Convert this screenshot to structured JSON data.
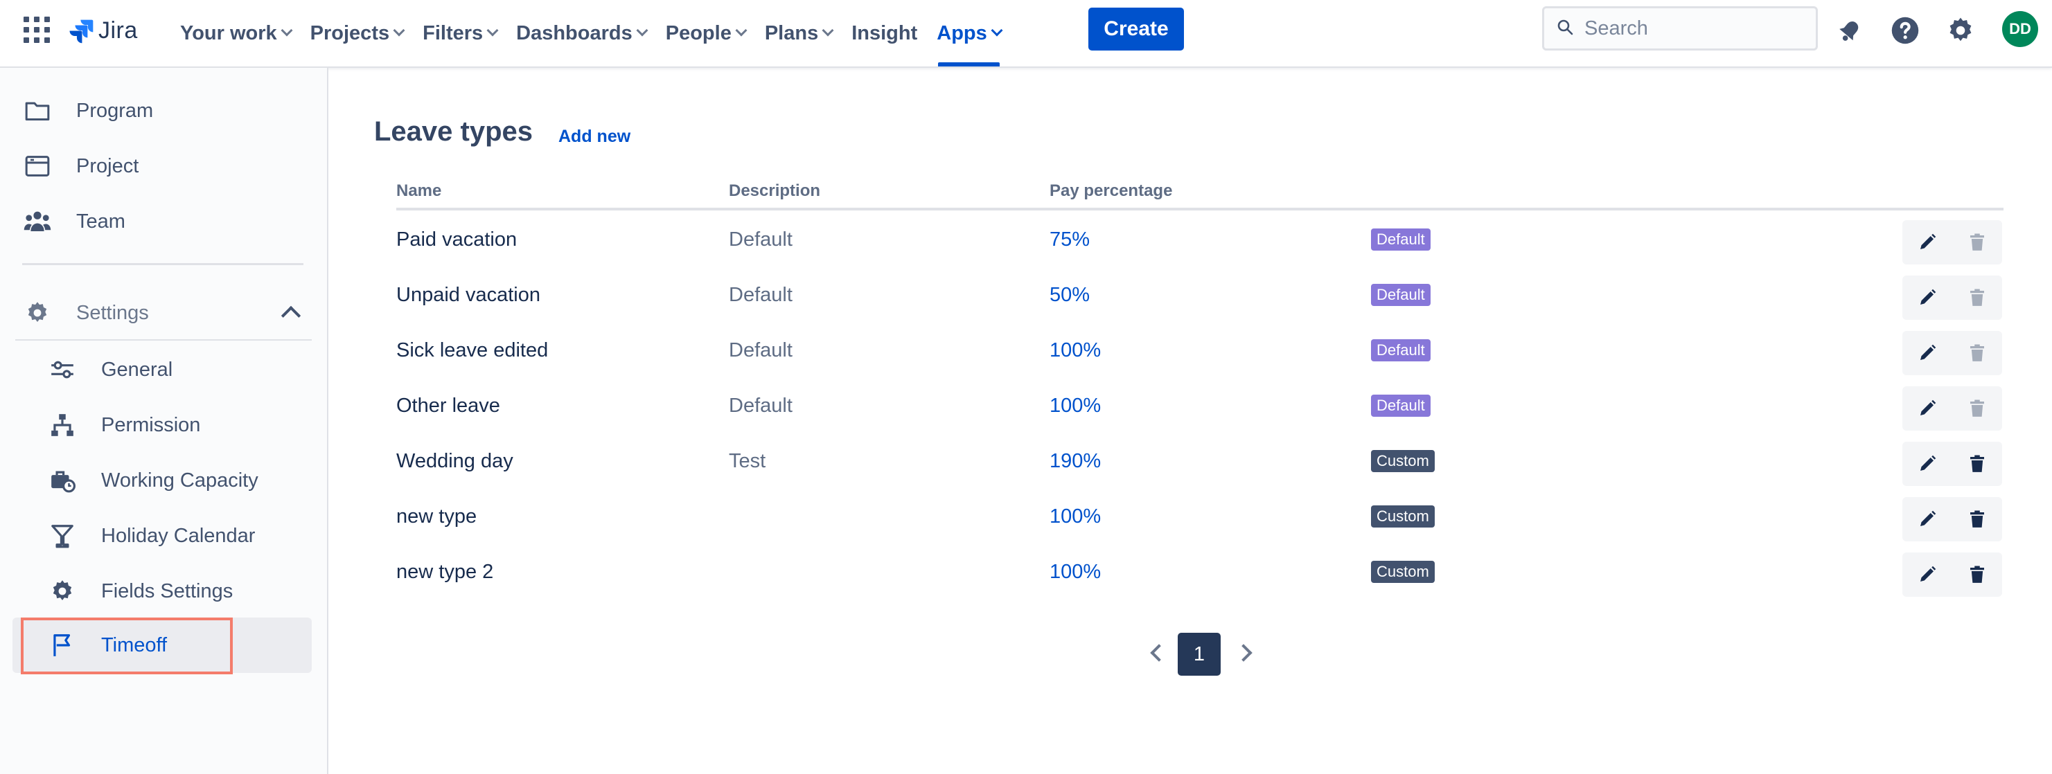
{
  "header": {
    "logo_text": "Jira",
    "nav": [
      {
        "label": "Your work",
        "dropdown": true
      },
      {
        "label": "Projects",
        "dropdown": true
      },
      {
        "label": "Filters",
        "dropdown": true
      },
      {
        "label": "Dashboards",
        "dropdown": true
      },
      {
        "label": "People",
        "dropdown": true
      },
      {
        "label": "Plans",
        "dropdown": true
      },
      {
        "label": "Insight",
        "dropdown": false
      },
      {
        "label": "Apps",
        "dropdown": true,
        "active": true
      }
    ],
    "create_label": "Create",
    "search_placeholder": "Search",
    "avatar_initials": "DD",
    "icons": [
      "app-switcher-icon",
      "notifications-icon",
      "help-icon",
      "settings-icon"
    ]
  },
  "sidebar": {
    "top_items": [
      {
        "label": "Program",
        "icon": "folder-icon"
      },
      {
        "label": "Project",
        "icon": "project-icon"
      },
      {
        "label": "Team",
        "icon": "team-icon"
      }
    ],
    "settings": {
      "label": "Settings",
      "icon": "gear-icon",
      "expanded": true,
      "items": [
        {
          "label": "General",
          "icon": "sliders-icon"
        },
        {
          "label": "Permission",
          "icon": "hierarchy-icon"
        },
        {
          "label": "Working Capacity",
          "icon": "briefcase-clock-icon"
        },
        {
          "label": "Holiday Calendar",
          "icon": "cocktail-icon"
        },
        {
          "label": "Fields Settings",
          "icon": "gear-icon"
        },
        {
          "label": "Timeoff",
          "icon": "flag-icon",
          "selected": true
        }
      ]
    }
  },
  "main": {
    "title": "Leave types",
    "add_new_label": "Add new",
    "columns": {
      "name": "Name",
      "description": "Description",
      "pay": "Pay percentage"
    },
    "rows": [
      {
        "name": "Paid vacation",
        "description": "Default",
        "pay": "75%",
        "badge": "Default",
        "deletable": false
      },
      {
        "name": "Unpaid vacation",
        "description": "Default",
        "pay": "50%",
        "badge": "Default",
        "deletable": false
      },
      {
        "name": "Sick leave edited",
        "description": "Default",
        "pay": "100%",
        "badge": "Default",
        "deletable": false
      },
      {
        "name": "Other leave",
        "description": "Default",
        "pay": "100%",
        "badge": "Default",
        "deletable": false
      },
      {
        "name": "Wedding day",
        "description": "Test",
        "pay": "190%",
        "badge": "Custom",
        "deletable": true
      },
      {
        "name": "new type",
        "description": "",
        "pay": "100%",
        "badge": "Custom",
        "deletable": true
      },
      {
        "name": "new type 2",
        "description": "",
        "pay": "100%",
        "badge": "Custom",
        "deletable": true
      }
    ],
    "pagination": {
      "current_page": "1"
    }
  },
  "colors": {
    "brand": "#0052CC",
    "badge_default": "#8777D9",
    "badge_custom": "#42526E",
    "highlight": "#F47C6B",
    "avatar": "#00875A"
  }
}
